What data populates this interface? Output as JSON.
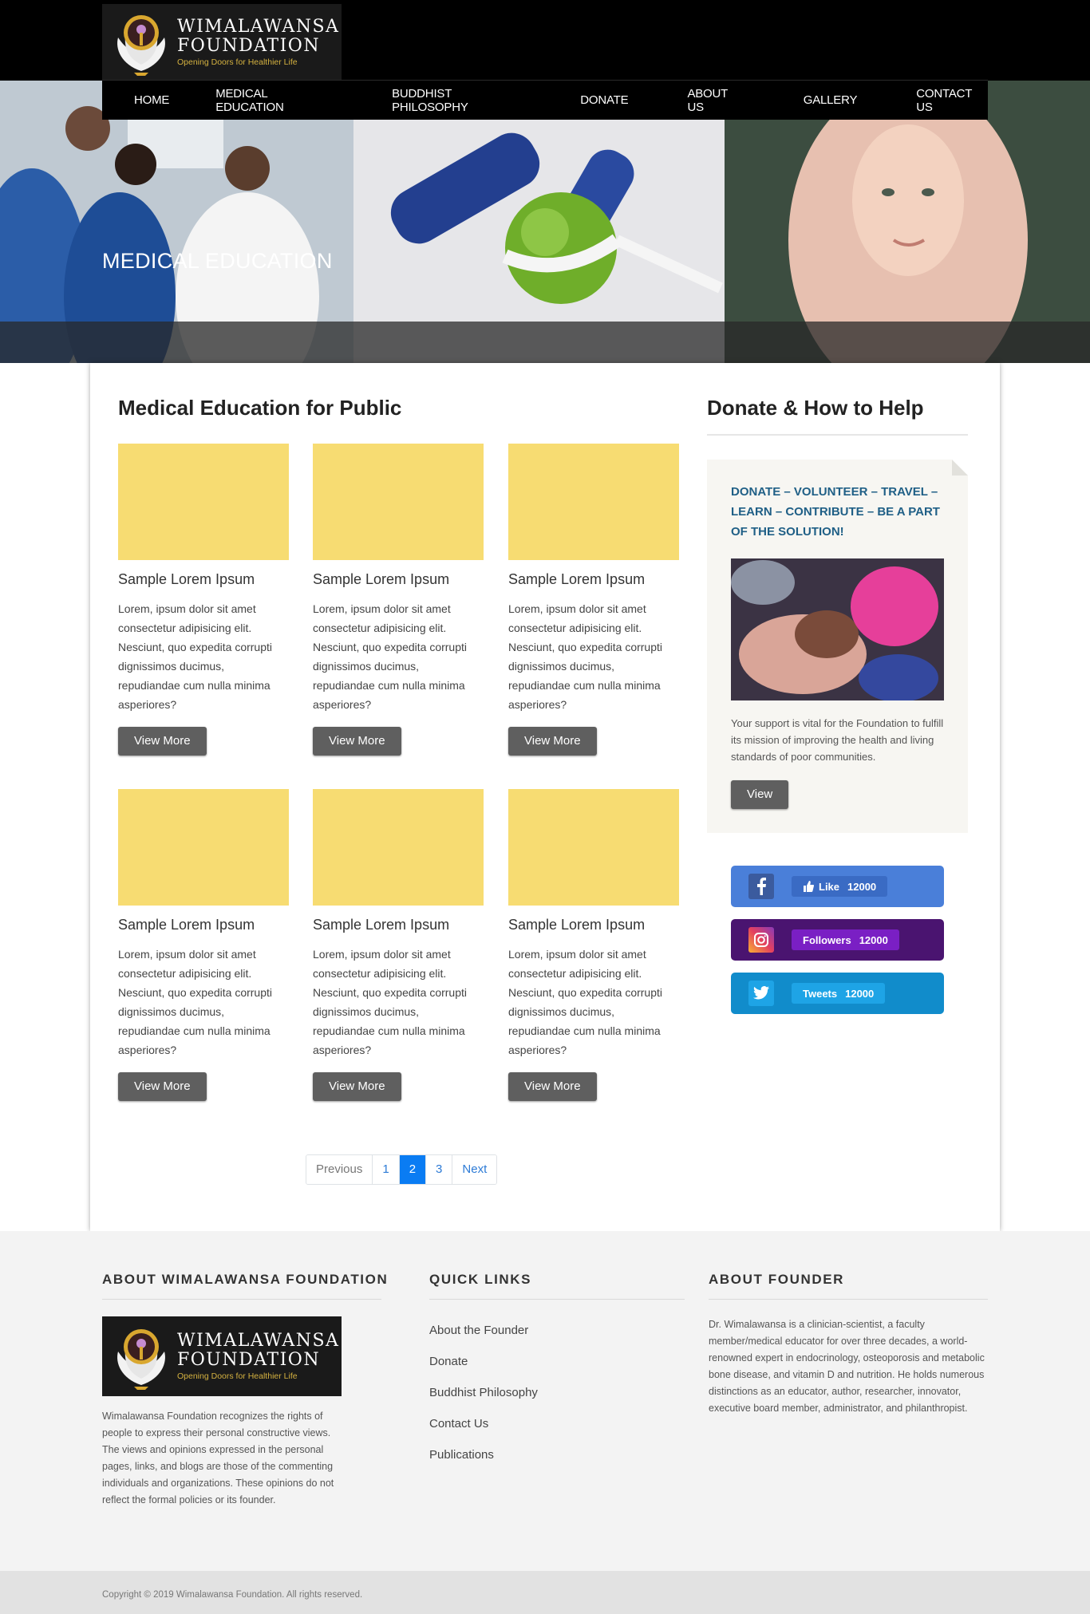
{
  "brand": {
    "name_line1": "WIMALAWANSA",
    "name_line2": "FOUNDATION",
    "tagline": "Opening Doors for Healthier Life"
  },
  "nav": {
    "items": [
      "HOME",
      "MEDICAL EDUCATION",
      "BUDDHIST PHILOSOPHY",
      "DONATE",
      "ABOUT US",
      "GALLERY",
      "CONTACT US"
    ]
  },
  "hero": {
    "title": "MEDICAL EDUCATION"
  },
  "main": {
    "title": "Medical Education for Public",
    "cards": [
      {
        "title": "Sample Lorem Ipsum",
        "text": "Lorem, ipsum dolor sit amet consectetur adipisicing elit. Nesciunt, quo expedita corrupti dignissimos ducimus, repudiandae cum nulla minima asperiores?",
        "button": "View More"
      },
      {
        "title": "Sample Lorem Ipsum",
        "text": "Lorem, ipsum dolor sit amet consectetur adipisicing elit. Nesciunt, quo expedita corrupti dignissimos ducimus, repudiandae cum nulla minima asperiores?",
        "button": "View More"
      },
      {
        "title": "Sample Lorem Ipsum",
        "text": "Lorem, ipsum dolor sit amet consectetur adipisicing elit. Nesciunt, quo expedita corrupti dignissimos ducimus, repudiandae cum nulla minima asperiores?",
        "button": "View More"
      },
      {
        "title": "Sample Lorem Ipsum",
        "text": "Lorem, ipsum dolor sit amet consectetur adipisicing elit. Nesciunt, quo expedita corrupti dignissimos ducimus, repudiandae cum nulla minima asperiores?",
        "button": "View More"
      },
      {
        "title": "Sample Lorem Ipsum",
        "text": "Lorem, ipsum dolor sit amet consectetur adipisicing elit. Nesciunt, quo expedita corrupti dignissimos ducimus, repudiandae cum nulla minima asperiores?",
        "button": "View More"
      },
      {
        "title": "Sample Lorem Ipsum",
        "text": "Lorem, ipsum dolor sit amet consectetur adipisicing elit. Nesciunt, quo expedita corrupti dignissimos ducimus, repudiandae cum nulla minima asperiores?",
        "button": "View More"
      }
    ],
    "card_image_color": "#f7dc72"
  },
  "pagination": {
    "previous": "Previous",
    "pages": [
      "1",
      "2",
      "3"
    ],
    "active_page": "2",
    "next": "Next"
  },
  "sidebar": {
    "title": "Donate & How to Help",
    "donate_headline": "DONATE – VOLUNTEER – TRAVEL – LEARN – CONTRIBUTE – BE A PART OF THE SOLUTION!",
    "donate_text": "Your support is vital for the Foundation to fulfill its mission of improving the health and living standards of poor communities.",
    "donate_button": "View",
    "social": [
      {
        "network": "facebook",
        "icon": "facebook-icon",
        "label": "Like",
        "count": "12000",
        "bg": "#4a7fd9",
        "pill": "#3a6bc4"
      },
      {
        "network": "instagram",
        "icon": "instagram-icon",
        "label": "Followers",
        "count": "12000",
        "bg": "#4a1470",
        "pill": "#7a1fc4"
      },
      {
        "network": "twitter",
        "icon": "twitter-icon",
        "label": "Tweets",
        "count": "12000",
        "bg": "#118ccb",
        "pill": "#1ea4e6"
      }
    ]
  },
  "footer": {
    "about_title": "ABOUT WIMALAWANSA FOUNDATION",
    "about_text": "Wimalawansa Foundation recognizes the rights of people to express their personal constructive views. The views and opinions expressed in the personal pages, links, and blogs are those of the commenting individuals and organizations. These opinions do not reflect the formal policies or its founder.",
    "links_title": "QUICK LINKS",
    "links": [
      "About the Founder",
      "Donate",
      "Buddhist Philosophy",
      "Contact Us",
      "Publications"
    ],
    "founder_title": "ABOUT FOUNDER",
    "founder_text": "Dr. Wimalawansa is a clinician-scientist, a faculty member/medical educator for over three decades, a world-renowned expert in endocrinology, osteoporosis and metabolic bone disease, and vitamin D and nutrition. He holds numerous distinctions as an educator, author, researcher, innovator, executive board member, administrator, and philanthropist.",
    "copyright": "Copyright © 2019 Wimalawansa Foundation. All rights reserved."
  }
}
